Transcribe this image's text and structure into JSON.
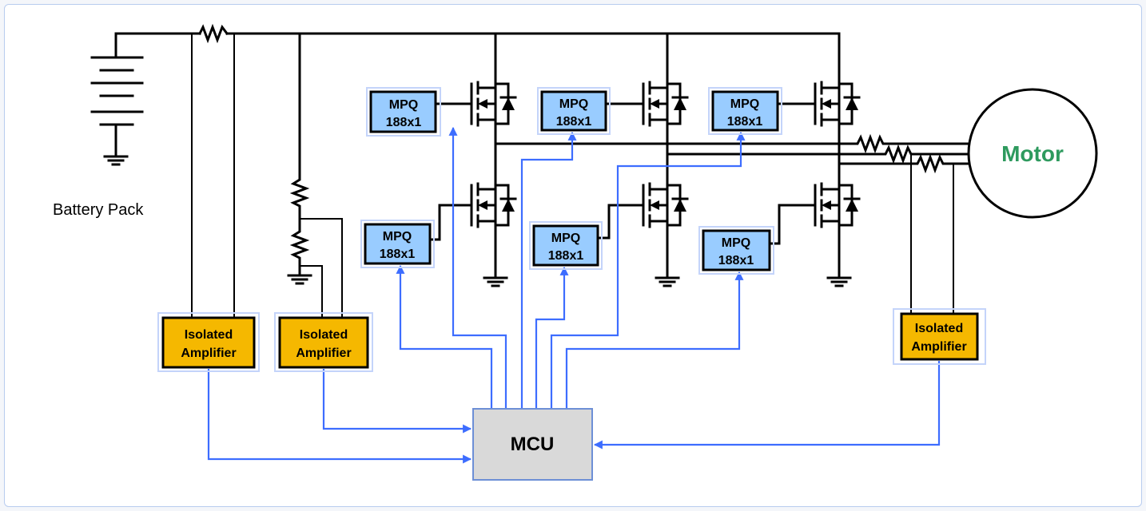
{
  "battery": {
    "label": "Battery Pack"
  },
  "motor": {
    "label": "Motor",
    "color": "#2e9a5e"
  },
  "mcu": {
    "label": "MCU",
    "fill": "#d9d9d9"
  },
  "drivers": [
    {
      "line1": "MPQ",
      "line2": "188x1"
    },
    {
      "line1": "MPQ",
      "line2": "188x1"
    },
    {
      "line1": "MPQ",
      "line2": "188x1"
    },
    {
      "line1": "MPQ",
      "line2": "188x1"
    },
    {
      "line1": "MPQ",
      "line2": "188x1"
    },
    {
      "line1": "MPQ",
      "line2": "188x1"
    }
  ],
  "amplifiers": [
    {
      "line1": "Isolated",
      "line2": "Amplifier"
    },
    {
      "line1": "Isolated",
      "line2": "Amplifier"
    },
    {
      "line1": "Isolated",
      "line2": "Amplifier"
    }
  ],
  "colors": {
    "driver_fill": "#99ccff",
    "amplifier_fill": "#f5b800",
    "signal_line": "#3d6dff",
    "wire": "#000000"
  }
}
